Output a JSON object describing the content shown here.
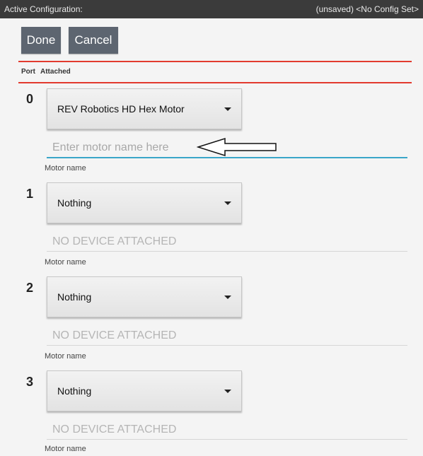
{
  "status_bar": {
    "left_text": "Active Configuration:",
    "right_text": "(unsaved) <No Config Set>"
  },
  "toolbar": {
    "done_label": "Done",
    "cancel_label": "Cancel"
  },
  "headers": {
    "port": "Port",
    "attached": "Attached"
  },
  "ports": [
    {
      "number": "0",
      "device": "REV Robotics HD Hex Motor",
      "field_placeholder": "Enter motor name here",
      "field_label": "Motor name"
    },
    {
      "number": "1",
      "device": "Nothing",
      "field_placeholder": "NO DEVICE ATTACHED",
      "field_label": "Motor name"
    },
    {
      "number": "2",
      "device": "Nothing",
      "field_placeholder": "NO DEVICE ATTACHED",
      "field_label": "Motor name"
    },
    {
      "number": "3",
      "device": "Nothing",
      "field_placeholder": "NO DEVICE ATTACHED",
      "field_label": "Motor name"
    }
  ],
  "colors": {
    "status_bar_bg": "#3b3b3b",
    "button_bg": "#5d6570",
    "divider_red": "#e23a2e",
    "focus_underline": "#3aa6c9"
  },
  "icons": {
    "dropdown": "caret-down-icon",
    "annotation": "arrow-left-icon"
  }
}
